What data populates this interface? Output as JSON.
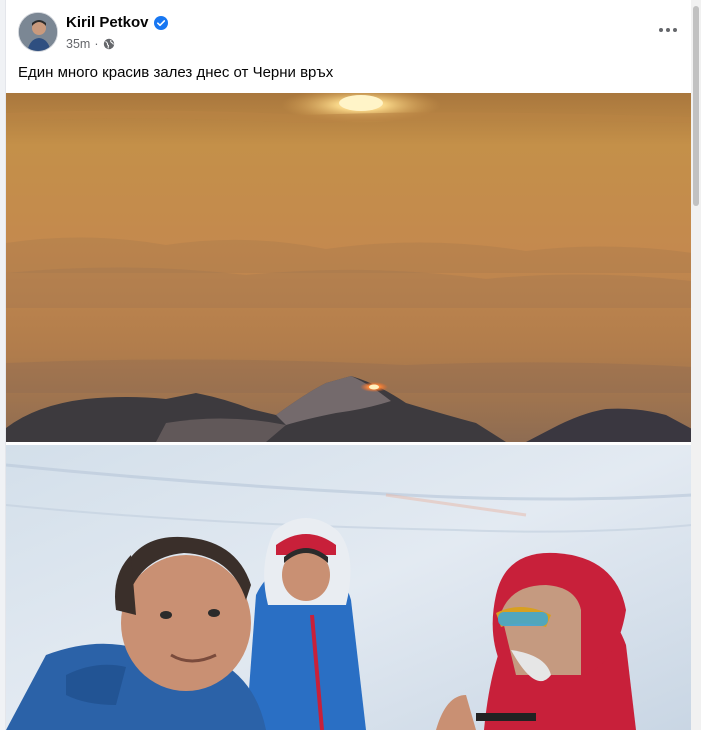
{
  "post": {
    "author": "Kiril Petkov",
    "time": "35m",
    "separator": "·",
    "caption": "Един много красив залез днес от Черни връх",
    "icons": {
      "verified": "verified-badge-icon",
      "audience": "globe-icon",
      "more": "more-options-icon"
    }
  },
  "colors": {
    "verified": "#1877f2",
    "sky_top": "#c08a45",
    "sky_horizon": "#b27d47",
    "snow": "#dde6ef",
    "jacket_blue": "#2a6fc4",
    "jacket_red": "#c8203a"
  }
}
